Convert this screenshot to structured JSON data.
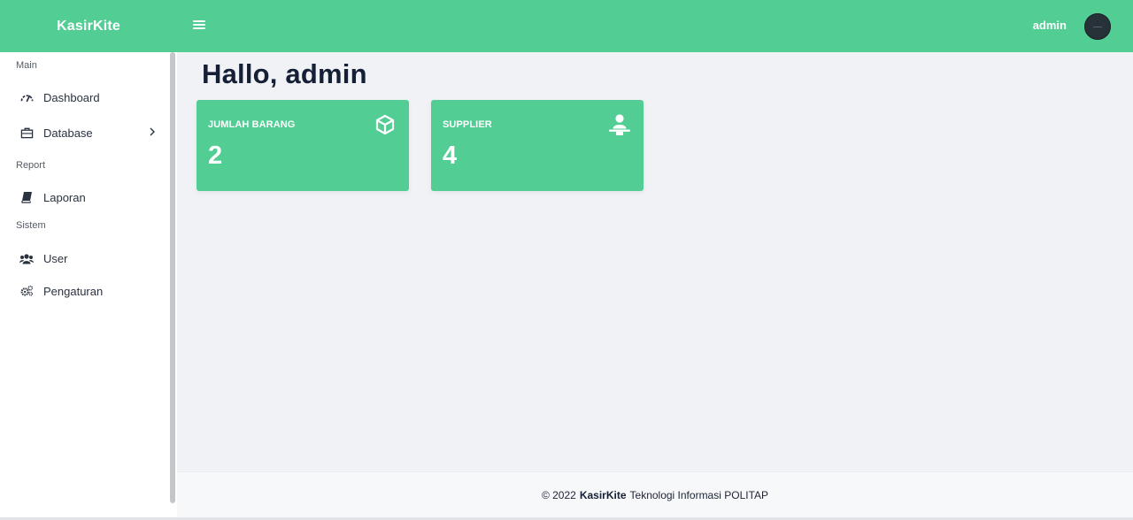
{
  "header": {
    "brand": "KasirKite",
    "menu_icon": "hamburger-menu-icon",
    "user_name": "admin",
    "avatar_icon": "user-avatar"
  },
  "sidebar": {
    "sections": [
      {
        "label": "Main"
      },
      {
        "label": "Report"
      },
      {
        "label": "Sistem"
      }
    ],
    "items": [
      {
        "label": "Dashboard",
        "icon": "gauge-icon"
      },
      {
        "label": "Database",
        "icon": "briefcase-icon",
        "has_submenu": true
      },
      {
        "label": "Laporan",
        "icon": "book-icon"
      },
      {
        "label": "User",
        "icon": "users-icon"
      },
      {
        "label": "Pengaturan",
        "icon": "gears-icon"
      }
    ]
  },
  "main": {
    "greeting": "Hallo, admin",
    "cards": [
      {
        "title": "JUMLAH BARANG",
        "value": "2",
        "icon": "cube-icon"
      },
      {
        "title": "SUPPLIER",
        "value": "4",
        "icon": "person-icon"
      }
    ]
  },
  "footer": {
    "prefix": "© 2022",
    "brand": "KasirKite",
    "suffix": "Teknologi Informasi POLITAP"
  },
  "colors": {
    "accent": "#52cd94",
    "background": "#f0f2f6",
    "text": "#152037"
  }
}
